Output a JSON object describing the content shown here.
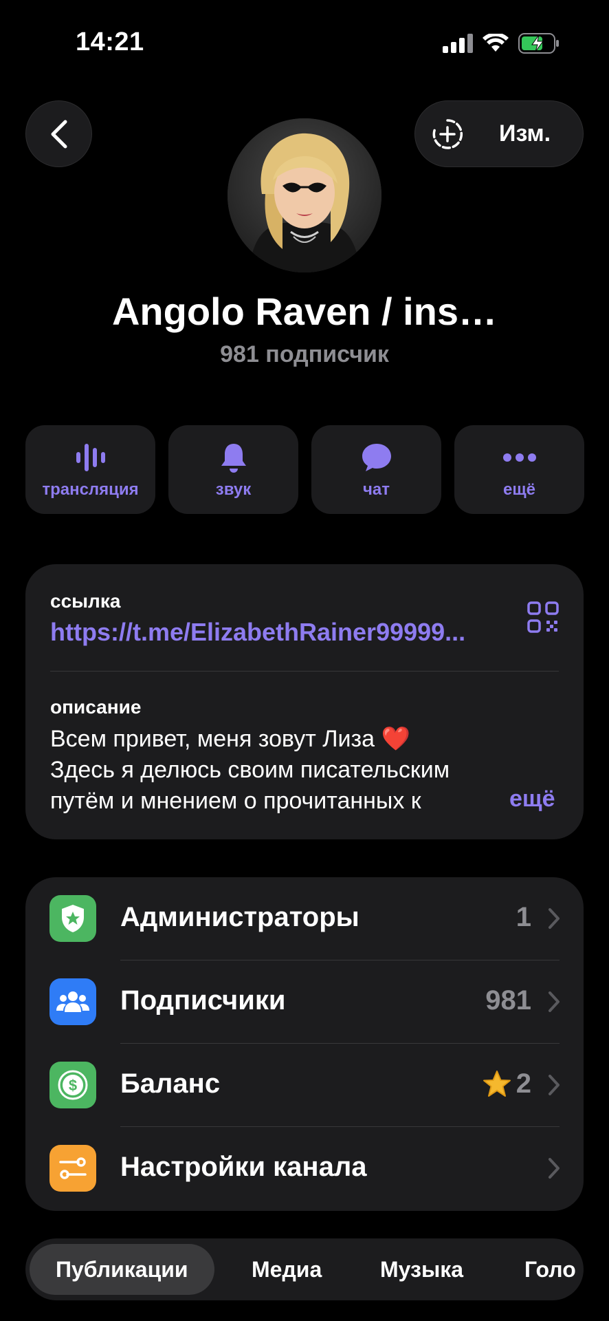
{
  "status_bar": {
    "time": "14:21"
  },
  "nav": {
    "edit_label": "Изм."
  },
  "channel": {
    "name": "Angolo Raven / ins…",
    "subscribers_line": "981 подписчик"
  },
  "actions": [
    {
      "label": "трансляция",
      "icon": "waveform-icon"
    },
    {
      "label": "звук",
      "icon": "bell-icon"
    },
    {
      "label": "чат",
      "icon": "chat-bubble-icon"
    },
    {
      "label": "ещё",
      "icon": "more-dots-icon"
    }
  ],
  "info": {
    "link_label": "ссылка",
    "link_value": "https://t.me/ElizabethRainer99999...",
    "description_label": "описание",
    "description_line1": "Всем привет, меня зовут Лиза ❤️",
    "description_line2": "Здесь я делюсь своим писательским",
    "description_line3": "путём и мнением о прочитанных к",
    "more_label": "ещё"
  },
  "menu": [
    {
      "label": "Администраторы",
      "value": "1",
      "icon": "shield-star-icon",
      "color": "#4cb661"
    },
    {
      "label": "Подписчики",
      "value": "981",
      "icon": "people-icon",
      "color": "#2f7cf6"
    },
    {
      "label": "Баланс",
      "value": "2",
      "icon": "dollar-icon",
      "color": "#4cb661",
      "badge": "star-icon"
    },
    {
      "label": "Настройки канала",
      "value": "",
      "icon": "settings-sliders-icon",
      "color": "#f7a233"
    }
  ],
  "tabs": [
    {
      "label": "Публикации",
      "active": true
    },
    {
      "label": "Медиа",
      "active": false
    },
    {
      "label": "Музыка",
      "active": false
    },
    {
      "label": "Голо",
      "active": false
    }
  ],
  "colors": {
    "accent": "#8e7cf0",
    "background": "#000000",
    "card": "#1c1c1e",
    "secondary_text": "#8e8e93"
  }
}
